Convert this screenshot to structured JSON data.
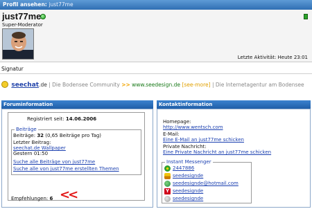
{
  "header": {
    "title": "Profil ansehen:",
    "username": "just77me"
  },
  "profile": {
    "username": "just77me",
    "role": "Super-Moderator",
    "last_activity": "Letzte Aktivität: Heute 23:01"
  },
  "signature": {
    "heading": "Signatur",
    "site_name": "seechat",
    "site_tld": ".de",
    "tagline1": "| Die Bodensee Community",
    "arrows": ">>",
    "url": "www.seedesign.de",
    "more": "[see-more]",
    "tagline2": "| Die Internetagentur am Bodensee"
  },
  "forum_info": {
    "heading": "Foruminformation",
    "registered_label": "Registriert seit:",
    "registered_date": "14.06.2006",
    "posts_legend": "Beiträge",
    "posts_label": "Beiträge:",
    "posts_count": "32",
    "posts_rate": "(0,65 Beiträge pro Tag)",
    "last_post_label": "Letzter Beitrag:",
    "last_post_link": "seechat.de Wallpaper",
    "last_post_time": "Gestern 01:50",
    "search_posts": "Suche alle Beiträge von just77me",
    "search_threads": "Suche alle von just77me erstellten Themen",
    "recommendations_label": "Empfehlungen:",
    "recommendations_count": "6",
    "annotation": "<<"
  },
  "contact_info": {
    "heading": "Kontaktinformation",
    "homepage_label": "Homepage:",
    "homepage_url": "http://www.wentsch.com",
    "email_label": "E-Mail:",
    "email_link": "Eine E-Mail an just77me schicken",
    "pm_label": "Private Nachricht:",
    "pm_link": "Eine Private Nachricht an just77me schicken",
    "im_legend": "Instant Messenger",
    "im": [
      {
        "icon": "icq-flower-icon",
        "value": "2447886"
      },
      {
        "icon": "aim-icon",
        "value": "seedesignde"
      },
      {
        "icon": "msn-icon",
        "value": "seedesignde@hotmail.com"
      },
      {
        "icon": "yahoo-icon",
        "value": "seedesignde"
      },
      {
        "icon": "skype-icon",
        "value": "seedesignde"
      }
    ]
  },
  "colors": {
    "accent": "#2f6fb3",
    "link": "#1a3fb0",
    "online": "#1d9e1d",
    "annotation": "#e31818"
  }
}
